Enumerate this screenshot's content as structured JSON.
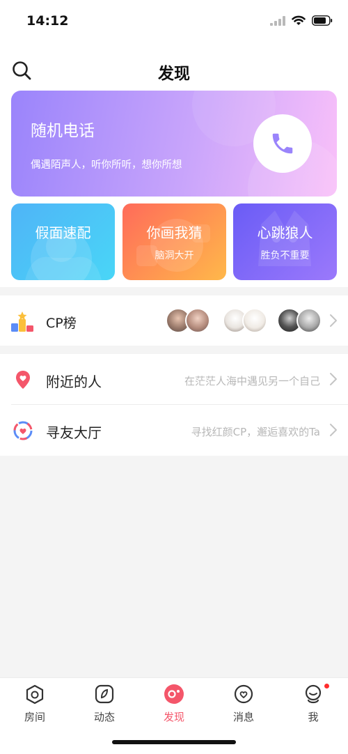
{
  "status_bar": {
    "time": "14:12"
  },
  "header": {
    "title": "发现",
    "search_icon": "search-icon"
  },
  "banner": {
    "title": "随机电话",
    "subtitle": "偶遇陌声人，听你所听，想你所想",
    "icon": "phone-icon",
    "colors": {
      "from": "#9a84fb",
      "to": "#f9c0f9",
      "icon": "#9a84fb"
    }
  },
  "feature_cards": [
    {
      "title": "假面速配",
      "subtitle": ""
    },
    {
      "title": "你画我猜",
      "subtitle": "脑洞大开"
    },
    {
      "title": "心跳狼人",
      "subtitle": "胜负不重要"
    }
  ],
  "cp_rank": {
    "label": "CP榜",
    "icon": "podium-icon"
  },
  "list": [
    {
      "label": "附近的人",
      "description": "在茫茫人海中遇见另一个自己",
      "icon": "location-pin-icon"
    },
    {
      "label": "寻友大厅",
      "description": "寻找红颜CP，邂逅喜欢的Ta",
      "icon": "friend-hall-icon"
    }
  ],
  "tabbar": {
    "items": [
      {
        "label": "房间",
        "icon": "room-icon"
      },
      {
        "label": "动态",
        "icon": "feed-icon"
      },
      {
        "label": "发现",
        "icon": "discover-icon",
        "active": true
      },
      {
        "label": "消息",
        "icon": "message-icon"
      },
      {
        "label": "我",
        "icon": "profile-icon",
        "badge": true
      }
    ],
    "active_color": "#f4566a"
  }
}
